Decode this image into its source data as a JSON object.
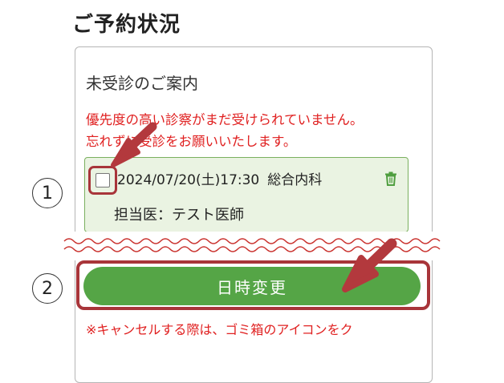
{
  "page": {
    "title": "ご予約状況"
  },
  "notice": {
    "heading": "未受診のご案内",
    "warning_line1": "優先度の高い診察がまだ受けられていません。",
    "warning_line2": "忘れずに受診をお願いいたします。"
  },
  "appointment": {
    "datetime": "2024/07/20(土)17:30",
    "department": "総合内科",
    "doctor": "担当医：テスト医師",
    "icon": "trash-icon"
  },
  "actions": {
    "change_label": "日時変更",
    "cancel_note": "※キャンセルする際は、ゴミ箱のアイコンをク"
  },
  "annotations": {
    "step1": "1",
    "step2": "2"
  },
  "colors": {
    "accent_green": "#55a546",
    "warning_red": "#e02020",
    "highlight_red": "#a8353a"
  }
}
